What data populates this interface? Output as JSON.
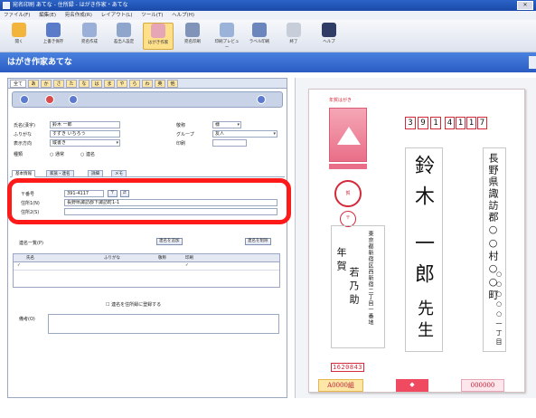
{
  "window": {
    "title": "宛名印刷 あてな - 住所録 - はがき作家・あてな"
  },
  "menu": [
    "ファイル(F)",
    "編集(E)",
    "宛名作成(R)",
    "レイアウト(L)",
    "ツール(T)",
    "ヘルプ(H)"
  ],
  "toolbar": [
    {
      "label": "開く",
      "icon": "folder-icon"
    },
    {
      "label": "上書き保存",
      "icon": "save-icon"
    },
    {
      "label": "宛名作成",
      "icon": "card-icon"
    },
    {
      "label": "差出人設定",
      "icon": "person-icon"
    },
    {
      "label": "はがき作家",
      "icon": "design-icon"
    },
    {
      "label": "宛名印刷",
      "icon": "print-icon"
    },
    {
      "label": "印刷プレビュー",
      "icon": "preview-icon"
    },
    {
      "label": "ラベル印刷",
      "icon": "label-icon"
    },
    {
      "label": "終了",
      "icon": "exit-icon"
    },
    {
      "label": "ヘルプ",
      "icon": "help-icon"
    }
  ],
  "appbar": {
    "title": "はがき作家あてな"
  },
  "form": {
    "name_label": "氏名(漢字)",
    "name_value": "鈴木 一郎",
    "kana_label": "ふりがな",
    "kana_value": "すずき いちろう",
    "honorific_label": "敬称",
    "honorific_value": "様",
    "group_label": "グループ",
    "group_value": "友人",
    "attr_label": "表示方向",
    "attr_value": "縦書き",
    "radio_a": "○ 通常",
    "radio_b": "○ 連名",
    "zip_label": "〒番号",
    "zip_value": "391-4117",
    "addr1_label": "住所1(N)",
    "addr1_value": "長野県諏訪郡下諏訪町1-1",
    "addr2_label": "住所2(S)",
    "addr2_value": "",
    "list_header": "連名一覧(P)",
    "list_btn1": "連名を追加",
    "list_btn2": "連名を削除",
    "grid_cols": [
      "氏名",
      "ふりがな",
      "敬称",
      "印刷"
    ],
    "grid_row": [
      "",
      "",
      "",
      "✓"
    ],
    "check_label": "☐ 連名を住所録に登録する",
    "memo_label": "備考(O)"
  },
  "tabs": [
    "あ",
    "か",
    "さ",
    "た",
    "な",
    "は",
    "ま",
    "や",
    "ら",
    "わ",
    "英",
    "他"
  ],
  "section_tabs": [
    "基本情報",
    "家族・連名",
    "詳細",
    "メモ"
  ],
  "postcard": {
    "recipient_zip": [
      "3",
      "9",
      "1",
      "4",
      "1",
      "1",
      "7"
    ],
    "recipient_address": "長野県諏訪郡○○村○○町",
    "recipient_address_line2": "○○○○○一丁目",
    "recipient_name_family": "鈴木",
    "recipient_name_given": "一郎",
    "recipient_honorific": "先生",
    "sender_address": "東京都新宿区西新宿二丁目一番地",
    "sender_greeting": "年賀",
    "sender_name": "若乃助",
    "sender_zip": "1620843",
    "stamp_label": "年賀はがき",
    "prize_left": "A0000組",
    "prize_right": "000000"
  }
}
